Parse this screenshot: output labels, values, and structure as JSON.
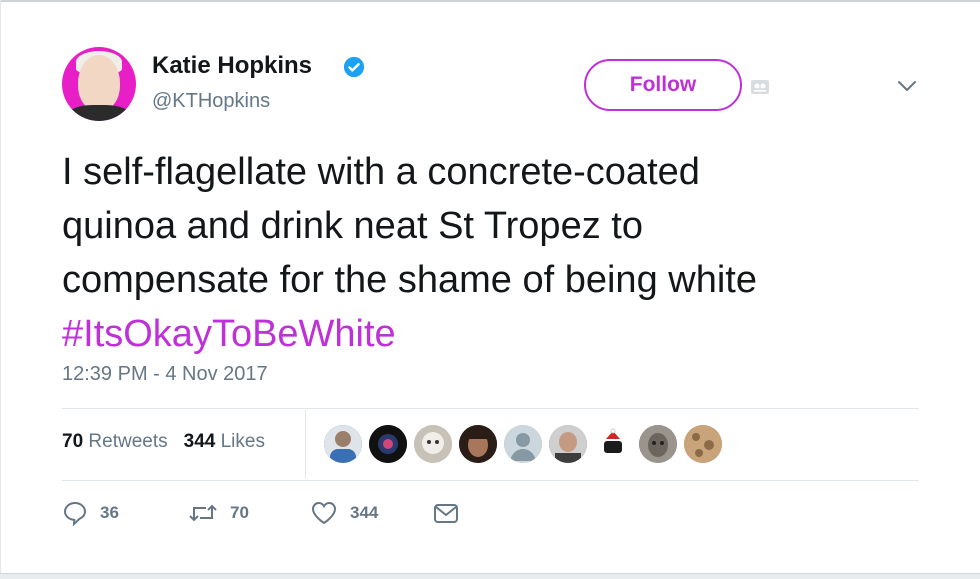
{
  "author": {
    "name": "Katie Hopkins",
    "handle": "@KTHopkins",
    "verified": true,
    "avatar_background": "#e81fc7"
  },
  "follow_button": {
    "label": "Follow",
    "accent_color": "#c030d9"
  },
  "tweet": {
    "lines": [
      "I self-flagellate with a concrete-coated",
      "quinoa and drink neat St Tropez to",
      "compensate for the shame of being white"
    ],
    "hashtag": "#ItsOkayToBeWhite",
    "timestamp": "12:39 PM - 4 Nov 2017"
  },
  "stats": {
    "retweets_count": "70",
    "retweets_label": "Retweets",
    "likes_count": "344",
    "likes_label": "Likes"
  },
  "liker_avatars": [
    {
      "icon": "liker-avatar-icon",
      "color": "#3b6fb5"
    },
    {
      "icon": "liker-avatar-icon",
      "color": "#1a1a2e"
    },
    {
      "icon": "liker-avatar-icon",
      "color": "#cfcac4"
    },
    {
      "icon": "liker-avatar-icon",
      "color": "#5a3a2a"
    },
    {
      "icon": "liker-avatar-icon",
      "color": "#aab8c2"
    },
    {
      "icon": "liker-avatar-icon",
      "color": "#7d6e62"
    },
    {
      "icon": "liker-avatar-icon",
      "color": "#ffffff"
    },
    {
      "icon": "liker-avatar-icon",
      "color": "#8c8680"
    },
    {
      "icon": "liker-avatar-icon",
      "color": "#b58e62"
    }
  ],
  "actions": {
    "reply_count": "36",
    "retweet_count": "70",
    "like_count": "344",
    "icons": [
      "reply-icon",
      "retweet-icon",
      "heart-icon",
      "mail-icon"
    ]
  }
}
